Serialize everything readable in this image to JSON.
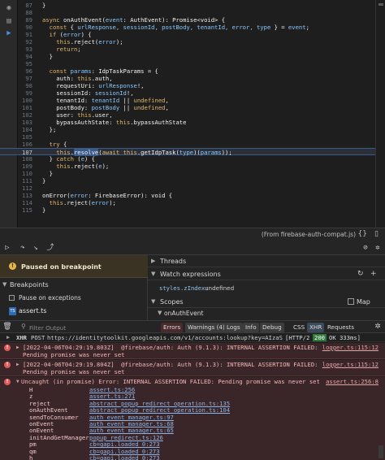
{
  "editor": {
    "lines": [
      {
        "n": "87",
        "segs": [
          {
            "t": "}",
            "c": "f"
          }
        ]
      },
      {
        "n": "88",
        "segs": []
      },
      {
        "n": "89",
        "segs": [
          {
            "t": "async ",
            "c": "k"
          },
          {
            "t": "onAuthEvent",
            "c": "f"
          },
          {
            "t": "(",
            "c": "f"
          },
          {
            "t": "event",
            "c": "p"
          },
          {
            "t": ": AuthEvent): Promise<void> {",
            "c": "f"
          }
        ]
      },
      {
        "n": "90",
        "segs": [
          {
            "t": "  const ",
            "c": "k"
          },
          {
            "t": "{ ",
            "c": "f"
          },
          {
            "t": "urlResponse, sessionId, postBody, tenantId, error, type",
            "c": "p"
          },
          {
            "t": " } = ",
            "c": "f"
          },
          {
            "t": "event",
            "c": "p"
          },
          {
            "t": ";",
            "c": "f"
          }
        ]
      },
      {
        "n": "91",
        "segs": [
          {
            "t": "  if ",
            "c": "k"
          },
          {
            "t": "(",
            "c": "f"
          },
          {
            "t": "error",
            "c": "p"
          },
          {
            "t": ") {",
            "c": "f"
          }
        ]
      },
      {
        "n": "92",
        "segs": [
          {
            "t": "    this",
            "c": "k"
          },
          {
            "t": ".reject(",
            "c": "f"
          },
          {
            "t": "error",
            "c": "p"
          },
          {
            "t": ");",
            "c": "f"
          }
        ]
      },
      {
        "n": "93",
        "segs": [
          {
            "t": "    return",
            "c": "k"
          },
          {
            "t": ";",
            "c": "f"
          }
        ]
      },
      {
        "n": "94",
        "segs": [
          {
            "t": "  }",
            "c": "f"
          }
        ]
      },
      {
        "n": "95",
        "segs": []
      },
      {
        "n": "96",
        "segs": [
          {
            "t": "  const ",
            "c": "k"
          },
          {
            "t": "params",
            "c": "p"
          },
          {
            "t": ": IdpTaskParams = {",
            "c": "f"
          }
        ]
      },
      {
        "n": "97",
        "segs": [
          {
            "t": "    auth: ",
            "c": "f"
          },
          {
            "t": "this",
            "c": "k"
          },
          {
            "t": ".auth,",
            "c": "f"
          }
        ]
      },
      {
        "n": "98",
        "segs": [
          {
            "t": "    requestUri: ",
            "c": "f"
          },
          {
            "t": "urlResponse",
            "c": "p"
          },
          {
            "t": "!,",
            "c": "f"
          }
        ]
      },
      {
        "n": "99",
        "segs": [
          {
            "t": "    sessionId: ",
            "c": "f"
          },
          {
            "t": "sessionId",
            "c": "p"
          },
          {
            "t": "!,",
            "c": "f"
          }
        ]
      },
      {
        "n": "100",
        "segs": [
          {
            "t": "    tenantId: ",
            "c": "f"
          },
          {
            "t": "tenantId",
            "c": "p"
          },
          {
            "t": " || ",
            "c": "f"
          },
          {
            "t": "undefined",
            "c": "k"
          },
          {
            "t": ",",
            "c": "f"
          }
        ]
      },
      {
        "n": "101",
        "segs": [
          {
            "t": "    postBody: ",
            "c": "f"
          },
          {
            "t": "postBody",
            "c": "p"
          },
          {
            "t": " || ",
            "c": "f"
          },
          {
            "t": "undefined",
            "c": "k"
          },
          {
            "t": ",",
            "c": "f"
          }
        ]
      },
      {
        "n": "102",
        "segs": [
          {
            "t": "    user: ",
            "c": "f"
          },
          {
            "t": "this",
            "c": "k"
          },
          {
            "t": ".user,",
            "c": "f"
          }
        ]
      },
      {
        "n": "103",
        "segs": [
          {
            "t": "    bypassAuthState: ",
            "c": "f"
          },
          {
            "t": "this",
            "c": "k"
          },
          {
            "t": ".bypassAuthState",
            "c": "f"
          }
        ]
      },
      {
        "n": "104",
        "segs": [
          {
            "t": "  };",
            "c": "f"
          }
        ]
      },
      {
        "n": "105",
        "segs": []
      },
      {
        "n": "106",
        "segs": [
          {
            "t": "  try ",
            "c": "k"
          },
          {
            "t": "{",
            "c": "f"
          }
        ]
      },
      {
        "n": "107",
        "current": true,
        "segs": [
          {
            "t": "    this",
            "c": "k"
          },
          {
            "t": ".",
            "c": "f"
          },
          {
            "t": "resolve",
            "c": "f",
            "hl": true
          },
          {
            "t": "(",
            "c": "f"
          },
          {
            "t": "await ",
            "c": "k"
          },
          {
            "t": "this",
            "c": "k"
          },
          {
            "t": ".getIdpTask(",
            "c": "f"
          },
          {
            "t": "type",
            "c": "p"
          },
          {
            "t": ")(",
            "c": "f"
          },
          {
            "t": "params",
            "c": "p"
          },
          {
            "t": "));",
            "c": "f"
          }
        ]
      },
      {
        "n": "108",
        "segs": [
          {
            "t": "  } ",
            "c": "f"
          },
          {
            "t": "catch ",
            "c": "k"
          },
          {
            "t": "(",
            "c": "f"
          },
          {
            "t": "e",
            "c": "p"
          },
          {
            "t": ") {",
            "c": "f"
          }
        ]
      },
      {
        "n": "109",
        "segs": [
          {
            "t": "    this",
            "c": "k"
          },
          {
            "t": ".reject(",
            "c": "f"
          },
          {
            "t": "e",
            "c": "p"
          },
          {
            "t": ");",
            "c": "f"
          }
        ]
      },
      {
        "n": "110",
        "segs": [
          {
            "t": "  }",
            "c": "f"
          }
        ]
      },
      {
        "n": "111",
        "segs": [
          {
            "t": "}",
            "c": "f"
          }
        ]
      },
      {
        "n": "112",
        "segs": []
      },
      {
        "n": "113",
        "segs": [
          {
            "t": "onError",
            "c": "f"
          },
          {
            "t": "(",
            "c": "f"
          },
          {
            "t": "error",
            "c": "p"
          },
          {
            "t": ": FirebaseError): void {",
            "c": "f"
          }
        ]
      },
      {
        "n": "114",
        "segs": [
          {
            "t": "  this",
            "c": "k"
          },
          {
            "t": ".reject(",
            "c": "f"
          },
          {
            "t": "error",
            "c": "p"
          },
          {
            "t": ");",
            "c": "f"
          }
        ]
      },
      {
        "n": "115",
        "segs": [
          {
            "t": "}",
            "c": "f"
          }
        ]
      }
    ],
    "source_status": "(From firebase-auth-compat.js)",
    "activity_icons": [
      "debug-icon",
      "files-icon",
      "source-icon"
    ]
  },
  "toolbar": {
    "buttons": [
      "step-over-icon",
      "step-into-icon",
      "step-out-icon",
      "deactivate-icon"
    ]
  },
  "left_pane": {
    "paused_label": "Paused on breakpoint",
    "breakpoints_label": "Breakpoints",
    "pause_on_exceptions_label": "Pause on exceptions",
    "file_label": "assert.ts",
    "file_icon_text": "TS"
  },
  "right_pane": {
    "threads_label": "Threads",
    "watch_label": "Watch expressions",
    "watch_name": "styles.zIndex",
    "watch_sep": ":",
    "watch_value": "undefined",
    "scopes_label": "Scopes",
    "map_label": "Map",
    "scope_item": "onAuthEvent"
  },
  "console_bar": {
    "filter_placeholder": "Filter Output",
    "errors": "Errors",
    "warnings": "Warnings (4)",
    "logs": "Logs",
    "info": "Info",
    "debug": "Debug",
    "css": "CSS",
    "xhr": "XHR",
    "requests": "Requests"
  },
  "console": {
    "net": {
      "type": "XHR",
      "method": "POST",
      "url": "https://identitytoolkit.googleapis.com/v1/accounts:lookup?key=AIzaSyDxwtGgkl",
      "http": "[HTTP/2",
      "status": "200",
      "status_rest": "OK 333ms]"
    },
    "errors": [
      {
        "line1": "[2022-04-06T04:29:19.803Z]  @firebase/auth: Auth (9.1.3): INTERNAL ASSERTION FAILED:",
        "line2": "Pending promise was never set",
        "src": "logger.ts:115:12"
      },
      {
        "line1": "[2022-04-06T04:29:19.804Z]  @firebase/auth: Auth (9.1.3): INTERNAL ASSERTION FAILED:",
        "line2": "Pending promise was never set",
        "src": "logger.ts:115:12"
      }
    ],
    "uncaught": {
      "text": "Uncaught (in promise) Error: INTERNAL ASSERTION FAILED: Pending promise was never set",
      "src": "assert.ts:256:8",
      "frames": [
        {
          "fn": "H",
          "loc": "assert.ts:256"
        },
        {
          "fn": "z",
          "loc": "assert.ts:271"
        },
        {
          "fn": "reject",
          "loc": "abstract_popup_redirect_operation.ts:135"
        },
        {
          "fn": "onAuthEvent",
          "loc": "abstract_popup_redirect_operation.ts:104"
        },
        {
          "fn": "sendToConsumer",
          "loc": "auth_event_manager.ts:97"
        },
        {
          "fn": "onEvent",
          "loc": "auth_event_manager.ts:68"
        },
        {
          "fn": "onEvent",
          "loc": "auth_event_manager.ts:65"
        },
        {
          "fn": "initAndGetManager",
          "loc": "popup_redirect.ts:126"
        },
        {
          "fn": "pm",
          "loc": "cb=gapi.loaded_0:273"
        },
        {
          "fn": "qm",
          "loc": "cb=gapi.loaded_0:273"
        },
        {
          "fn": "h",
          "loc": "cb=gapi.loaded_0:273"
        }
      ]
    }
  }
}
